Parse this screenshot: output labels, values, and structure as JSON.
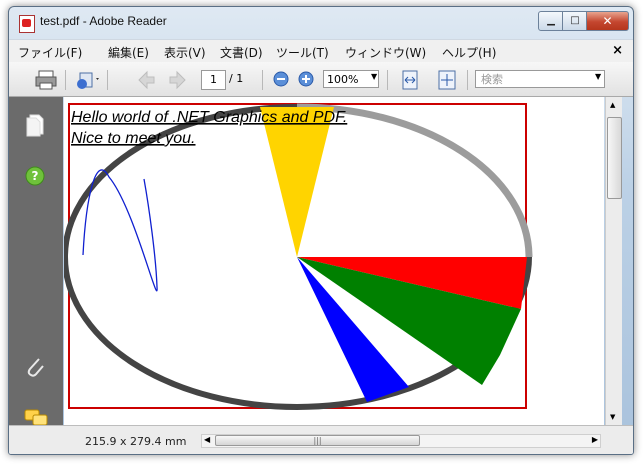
{
  "window": {
    "title": "test.pdf - Adobe Reader"
  },
  "menu": [
    {
      "label": "ファイル(F)"
    },
    {
      "label": "編集(E)"
    },
    {
      "label": "表示(V)"
    },
    {
      "label": "文書(D)"
    },
    {
      "label": "ツール(T)"
    },
    {
      "label": "ウィンドウ(W)"
    },
    {
      "label": "ヘルプ(H)"
    }
  ],
  "toolbar": {
    "page_current": "1",
    "page_total": "/ 1",
    "zoom": "100%",
    "search_placeholder": "検索"
  },
  "document": {
    "line1": "Hello world of .NET Graphics and PDF.",
    "line2": "Nice to meet you."
  },
  "status": {
    "page_size": "215.9 x 279.4 mm"
  },
  "colors": {
    "pie_yellow": "#ffd400",
    "pie_red": "#ff0000",
    "pie_green": "#008000",
    "pie_blue": "#0000ff",
    "frame": "#cc0000"
  }
}
